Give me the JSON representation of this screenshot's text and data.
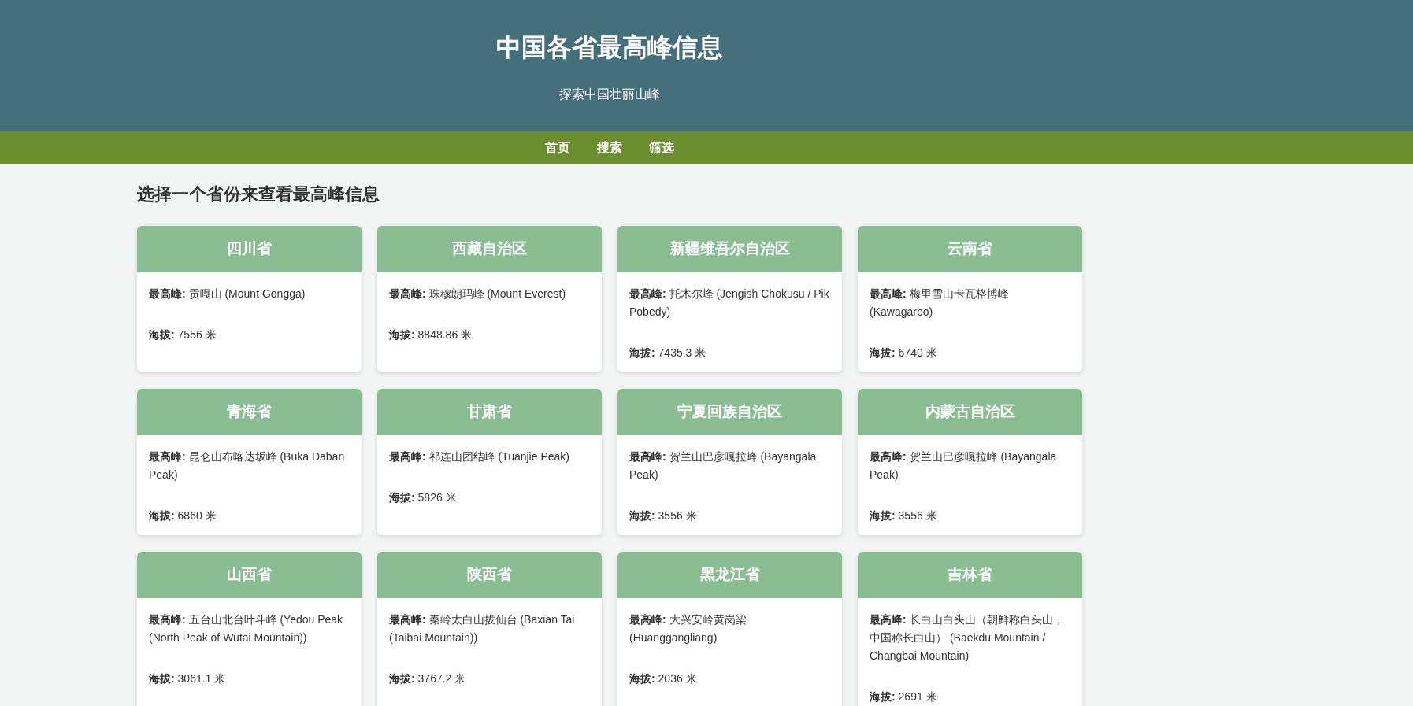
{
  "header": {
    "title": "中国各省最高峰信息",
    "subtitle": "探索中国壮丽山峰"
  },
  "nav": [
    {
      "label": "首页"
    },
    {
      "label": "搜索"
    },
    {
      "label": "筛选"
    }
  ],
  "section_title": "选择一个省份来查看最高峰信息",
  "provinces": [
    {
      "name": "四川省",
      "peak_label": "最高峰:",
      "peak": "贡嘎山 (Mount Gongga)",
      "altitude_label": "海拔:",
      "altitude": "7556 米"
    },
    {
      "name": "西藏自治区",
      "peak_label": "最高峰:",
      "peak": "珠穆朗玛峰 (Mount Everest)",
      "altitude_label": "海拔:",
      "altitude": "8848.86 米"
    },
    {
      "name": "新疆维吾尔自治区",
      "peak_label": "最高峰:",
      "peak": "托木尔峰 (Jengish Chokusu / Pik Pobedy)",
      "altitude_label": "海拔:",
      "altitude": "7435.3 米"
    },
    {
      "name": "云南省",
      "peak_label": "最高峰:",
      "peak": "梅里雪山卡瓦格博峰 (Kawagarbo)",
      "altitude_label": "海拔:",
      "altitude": "6740 米"
    },
    {
      "name": "青海省",
      "peak_label": "最高峰:",
      "peak": "昆仑山布喀达坂峰 (Buka Daban Peak)",
      "altitude_label": "海拔:",
      "altitude": "6860 米"
    },
    {
      "name": "甘肃省",
      "peak_label": "最高峰:",
      "peak": "祁连山团结峰 (Tuanjie Peak)",
      "altitude_label": "海拔:",
      "altitude": "5826 米"
    },
    {
      "name": "宁夏回族自治区",
      "peak_label": "最高峰:",
      "peak": "贺兰山巴彦嘎拉峰 (Bayangala Peak)",
      "altitude_label": "海拔:",
      "altitude": "3556 米"
    },
    {
      "name": "内蒙古自治区",
      "peak_label": "最高峰:",
      "peak": "贺兰山巴彦嘎拉峰 (Bayangala Peak)",
      "altitude_label": "海拔:",
      "altitude": "3556 米"
    },
    {
      "name": "山西省",
      "peak_label": "最高峰:",
      "peak": "五台山北台叶斗峰 (Yedou Peak (North Peak of Wutai Mountain))",
      "altitude_label": "海拔:",
      "altitude": "3061.1 米"
    },
    {
      "name": "陕西省",
      "peak_label": "最高峰:",
      "peak": "秦岭太白山拔仙台 (Baxian Tai (Taibai Mountain))",
      "altitude_label": "海拔:",
      "altitude": "3767.2 米"
    },
    {
      "name": "黑龙江省",
      "peak_label": "最高峰:",
      "peak": "大兴安岭黄岗梁 (Huanggangliang)",
      "altitude_label": "海拔:",
      "altitude": "2036 米"
    },
    {
      "name": "吉林省",
      "peak_label": "最高峰:",
      "peak": "长白山白头山（朝鲜称白头山，中国称长白山） (Baekdu Mountain / Changbai Mountain)",
      "altitude_label": "海拔:",
      "altitude": "2691 米"
    }
  ]
}
